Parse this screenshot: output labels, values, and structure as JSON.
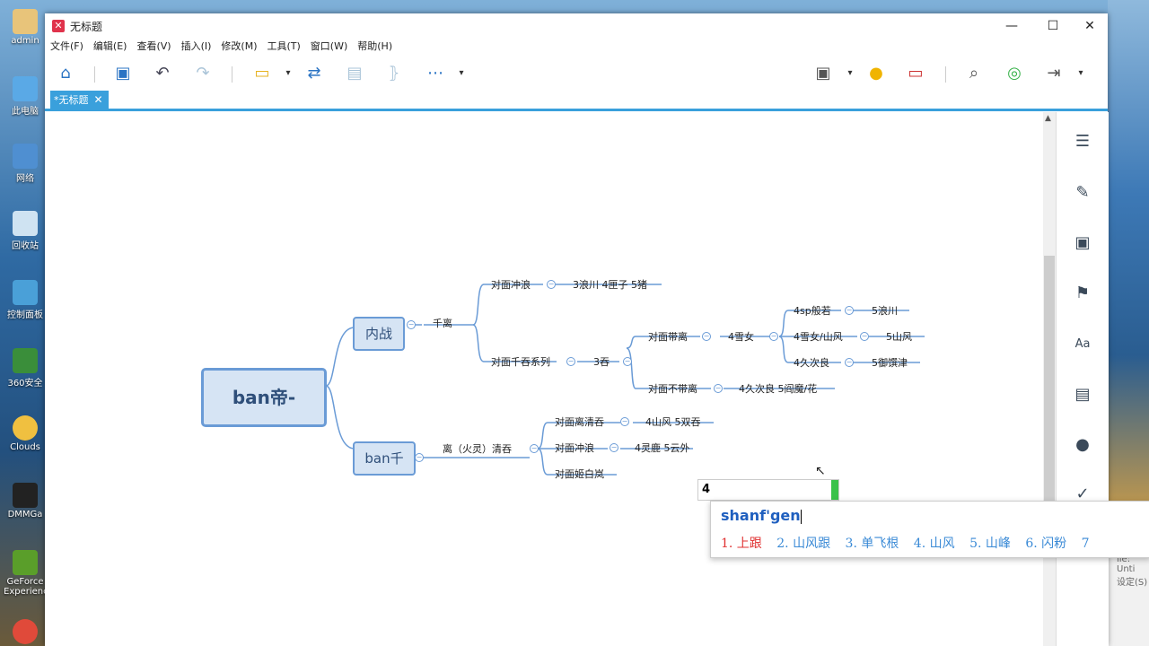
{
  "desktop": {
    "icons": [
      "admin",
      "此电脑",
      "网络",
      "回收站",
      "控制面板",
      "360安全",
      "Clouds",
      "DMMGa",
      "GeForce Experience"
    ]
  },
  "window": {
    "title": "无标题",
    "menu": [
      "文件(F)",
      "编辑(E)",
      "查看(V)",
      "插入(I)",
      "修改(M)",
      "工具(T)",
      "窗口(W)",
      "帮助(H)"
    ],
    "tab": "*无标题"
  },
  "mindmap": {
    "root": "ban帝-",
    "neizhan": "内战",
    "qianli": "千离",
    "dm_chonglang": "对面冲浪",
    "dm_chonglang_v": "3浪川 4匣子 5猪",
    "dm_qiantun": "对面千吞系列",
    "tun3": "3吞",
    "dm_dai_li": "对面带离",
    "xuenv4": "4雪女",
    "sp4": "4sp般若",
    "lang5": "5浪川",
    "xuenv_shanfeng4": "4雪女/山风",
    "shanfeng5": "5山风",
    "jiuciliang4": "4久次良",
    "yuzhuanjin5": "5御馔津",
    "dm_budai_li": "对面不带离",
    "budai_v": "4久次良 5阎魔/花",
    "ban_qian": "ban千",
    "li_huoling": "离（火灵）清吞",
    "dm_li_qingtun": "对面离清吞",
    "li_qingtun_v": "4山风 5双吞",
    "dm_chonglang2": "对面冲浪",
    "chonglang2_v": "4灵鹿 5云外",
    "dm_jibailan": "对面姬白岚"
  },
  "ime": {
    "input_value": "4",
    "composition": "shanf'gen",
    "candidates": [
      "1. 上跟",
      "2. 山风跟",
      "3. 单飞根",
      "4. 山风",
      "5. 山峰",
      "6. 闪粉",
      "7"
    ]
  },
  "bg_window": {
    "label1": "ile: Unti",
    "label2": "设定(S)"
  }
}
